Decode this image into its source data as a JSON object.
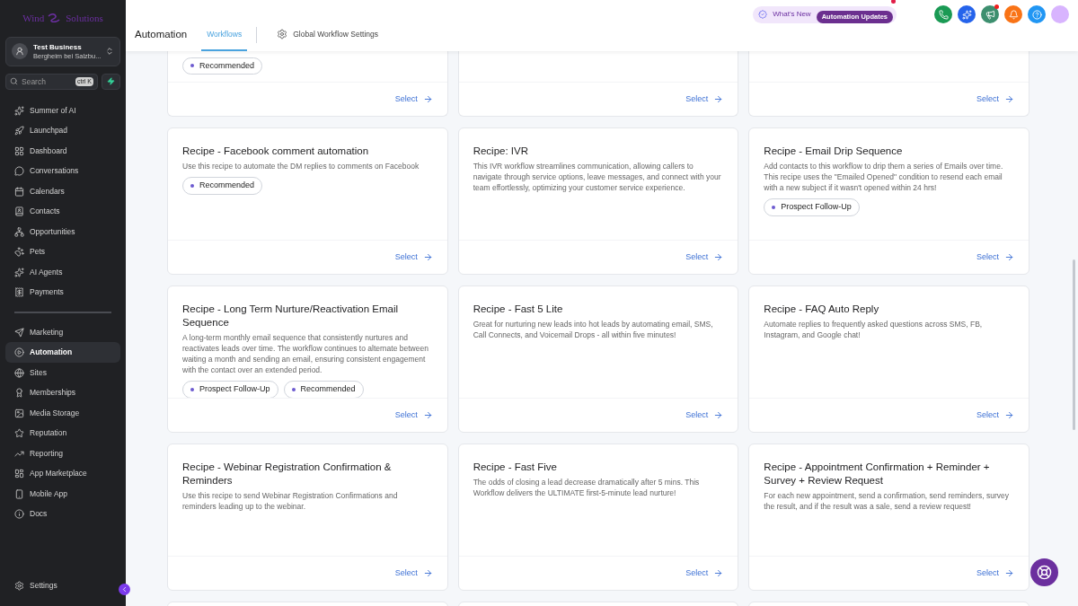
{
  "logo": {
    "left": "Wind",
    "right": "Solutions"
  },
  "account": {
    "name": "Test Business",
    "location": "Bergheim bei Salzbu..."
  },
  "search": {
    "placeholder": "Search",
    "shortcut": "ctrl K"
  },
  "nav_groups": [
    [
      {
        "label": "Summer of AI",
        "selected": false
      },
      {
        "label": "Launchpad",
        "selected": false
      },
      {
        "label": "Dashboard",
        "selected": false
      },
      {
        "label": "Conversations",
        "selected": false
      },
      {
        "label": "Calendars",
        "selected": false
      },
      {
        "label": "Contacts",
        "selected": false
      },
      {
        "label": "Opportunities",
        "selected": false
      },
      {
        "label": "Pets",
        "selected": false
      },
      {
        "label": "AI Agents",
        "selected": false
      },
      {
        "label": "Payments",
        "selected": false
      }
    ],
    [
      {
        "label": "Marketing",
        "selected": false
      },
      {
        "label": "Automation",
        "selected": true
      },
      {
        "label": "Sites",
        "selected": false
      },
      {
        "label": "Memberships",
        "selected": false
      },
      {
        "label": "Media Storage",
        "selected": false
      },
      {
        "label": "Reputation",
        "selected": false
      },
      {
        "label": "Reporting",
        "selected": false
      },
      {
        "label": "App Marketplace",
        "selected": false
      },
      {
        "label": "Mobile App",
        "selected": false
      },
      {
        "label": "Docs",
        "selected": false
      }
    ]
  ],
  "settings": {
    "label": "Settings"
  },
  "header": {
    "title": "Automation",
    "tabs": [
      {
        "label": "Workflows",
        "selected": true
      },
      {
        "label": "Global Workflow Settings",
        "selected": false
      }
    ],
    "whats_new": "What's New",
    "updates_button": "Automation Updates",
    "actions": [
      {
        "color": "#1a9a54",
        "dot": false
      },
      {
        "color": "#2563eb",
        "dot": false
      },
      {
        "color": "#3d8f6f",
        "dot": true
      },
      {
        "color": "#f97316",
        "dot": false
      },
      {
        "color": "#2196f3",
        "dot": false
      }
    ]
  },
  "partial_cards": [
    {
      "tags": [
        "Recommended"
      ],
      "action": "Select"
    },
    {
      "action": "Select"
    },
    {
      "action": "Select"
    }
  ],
  "cards": [
    {
      "title": "Recipe - Facebook comment automation",
      "description": "Use this recipe to automate the DM replies to comments on Facebook",
      "tags": [
        "Recommended"
      ],
      "action": "Select"
    },
    {
      "title": "Recipe: IVR",
      "description": "This IVR workflow streamlines communication, allowing callers to navigate through service options, leave messages, and connect with your team effortlessly, optimizing your customer service experience.",
      "action": "Select"
    },
    {
      "title": "Recipe - Email Drip Sequence",
      "description": "Add contacts to this workflow to drip them a series of Emails over time. This recipe uses the \"Emailed Opened\" condition to resend each email with a new subject if it wasn't opened within 24 hrs!",
      "tags": [
        "Prospect Follow-Up"
      ],
      "action": "Select"
    },
    {
      "title": "Recipe - Long Term Nurture/Reactivation Email Sequence",
      "description": "A long-term monthly email sequence that consistently nurtures and reactivates leads over time. The workflow continues to alternate between waiting a month and sending an email, ensuring consistent engagement with the contact over an extended period.",
      "tags": [
        "Prospect Follow-Up",
        "Recommended"
      ],
      "action": "Select"
    },
    {
      "title": "Recipe - Fast 5 Lite",
      "description": "Great for nurturing new leads into hot leads by automating email, SMS, Call Connects, and Voicemail Drops - all within five minutes!",
      "action": "Select"
    },
    {
      "title": "Recipe - FAQ Auto Reply",
      "description": "Automate replies to frequently asked questions across SMS, FB, Instagram, and Google chat!",
      "action": "Select"
    },
    {
      "title": "Recipe - Webinar Registration Confirmation & Reminders",
      "description": "Use this recipe to send Webinar Registration Confirmations and reminders leading up to the webinar.",
      "action": "Select"
    },
    {
      "title": "Recipe - Fast Five",
      "description": "The odds of closing a lead decrease dramatically after 5 mins. This Workflow delivers the ULTIMATE first-5-minute lead nurture!",
      "action": "Select"
    },
    {
      "title": "Recipe - Appointment Confirmation + Reminder + Survey + Review Request",
      "description": "For each new appointment, send a confirmation, send reminders, survey the result, and if the result was a sale, send a review request!",
      "action": "Select"
    }
  ]
}
